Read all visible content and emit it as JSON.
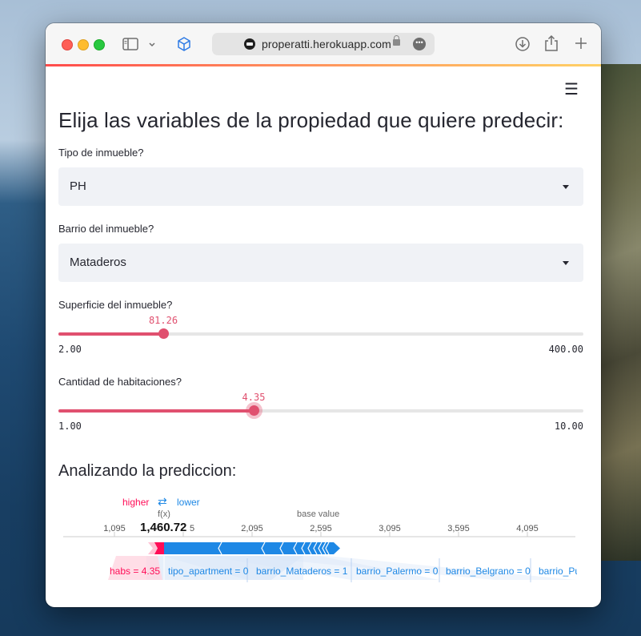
{
  "browser": {
    "url": "properatti.herokuapp.com",
    "icons": [
      "sidebar-icon",
      "chevron-down-icon",
      "cube-icon",
      "download-icon",
      "share-icon",
      "plus-icon",
      "lock-icon",
      "more-icon"
    ]
  },
  "page": {
    "title": "Elija las variables de la propiedad que quiere predecir:",
    "menu_icon": "hamburger-menu-icon"
  },
  "form": {
    "tipo": {
      "label": "Tipo de inmueble?",
      "value": "PH"
    },
    "barrio": {
      "label": "Barrio del inmueble?",
      "value": "Mataderos"
    },
    "superficie": {
      "label": "Superficie del inmueble?",
      "value": "81.26",
      "min": "2.00",
      "max": "400.00",
      "fraction": 0.2
    },
    "habitaciones": {
      "label": "Cantidad de habitaciones?",
      "value": "4.35",
      "min": "1.00",
      "max": "10.00",
      "fraction": 0.372
    }
  },
  "analysis": {
    "title": "Analizando la prediccion:",
    "higher_label": "higher",
    "swap_icon": "⇄",
    "lower_label": "lower",
    "fx_label": "f(x)",
    "fx_value": "1,460.72",
    "base_value_label": "base value",
    "ticks": [
      "1,095",
      "5",
      "2,095",
      "2,595",
      "3,095",
      "3,595",
      "4,095"
    ],
    "contributions": [
      {
        "label": "habs = 4.35",
        "effect": "higher"
      },
      {
        "label": "tipo_apartment = 0",
        "effect": "lower"
      },
      {
        "label": "barrio_Mataderos = 1",
        "effect": "lower"
      },
      {
        "label": "barrio_Palermo = 0",
        "effect": "lower"
      },
      {
        "label": "barrio_Belgrano = 0",
        "effect": "lower"
      },
      {
        "label": "barrio_Pu",
        "effect": "lower"
      }
    ],
    "colors": {
      "higher": "#ff0d57",
      "lower": "#1e88e5",
      "slider": "#e0506f"
    }
  }
}
